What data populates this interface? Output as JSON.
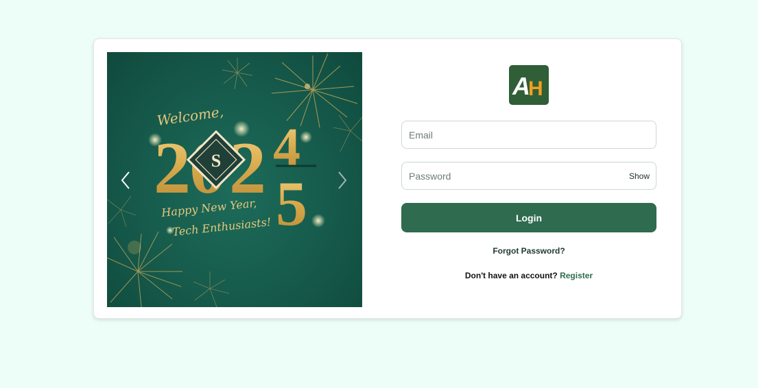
{
  "carousel": {
    "slide": {
      "welcome_text": "Welcome,",
      "year_main": "2024",
      "year_new_digit": "5",
      "greeting_line1": "Happy New Year,",
      "greeting_line2": "Tech Enthusiasts!"
    }
  },
  "logo": {
    "letter_a": "A",
    "letter_h": "H"
  },
  "form": {
    "email_placeholder": "Email",
    "password_placeholder": "Password",
    "show_label": "Show",
    "login_label": "Login",
    "forgot_label": "Forgot Password?",
    "no_account_text": "Don't have an account?",
    "register_label": "Register"
  },
  "colors": {
    "page_background": "#edfdf7",
    "primary_green": "#2e6b4f",
    "gold": "#d8ad50",
    "logo_background": "#2f5e37",
    "logo_orange": "#f0a020"
  },
  "icons": {
    "prev": "chevron-left-icon",
    "next": "chevron-right-icon"
  }
}
